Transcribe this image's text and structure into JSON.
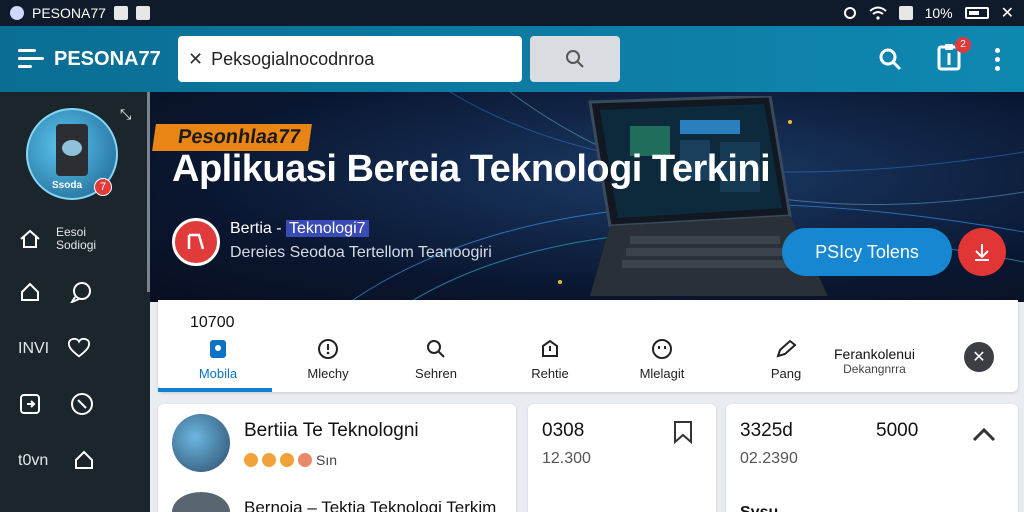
{
  "status_bar": {
    "app_name": "PESONA77",
    "battery": "10%"
  },
  "app_bar": {
    "brand": "PESONA77",
    "search_value": "Peksogialnocodnroa",
    "notification_count": "2"
  },
  "sidebar": {
    "avatar_label": "Ssoda",
    "avatar_badge": "7",
    "items": [
      {
        "icon": "home-icon",
        "label": "Eesoi\nSodiogi"
      },
      {
        "icon": "house-icon",
        "icon2": "chat-icon"
      },
      {
        "icon": "bars-icon",
        "label": "INVI",
        "icon2": "heart-icon"
      },
      {
        "icon": "login-icon",
        "icon2": "clock-icon"
      },
      {
        "icon": "grid-icon",
        "label": "t0vn",
        "icon2": "house-icon"
      }
    ]
  },
  "hero": {
    "tag": "Pesonhlaa77",
    "title": "Aplikuasi Bereia Teknologi Terkini",
    "source_prefix": "Bertia - ",
    "source_highlight": "Teknologi7",
    "source_sub": "Dereies Seodoa Tertellom Teanoogiri",
    "cta_label": "PSIcy Tolens"
  },
  "tabs": {
    "count": "10700",
    "items": [
      {
        "icon": "mobile-icon",
        "label": "Mobila",
        "active": true
      },
      {
        "icon": "info-icon",
        "label": "Mlechy"
      },
      {
        "icon": "search-icon",
        "label": "Sehren"
      },
      {
        "icon": "update-icon",
        "label": "Rehtie"
      },
      {
        "icon": "mask-icon",
        "label": "Mlelagit"
      },
      {
        "icon": "pen-icon",
        "label": "Pang"
      }
    ],
    "extra_title": "Ferankolenui",
    "extra_sub": "Dekangnrra"
  },
  "feed": {
    "card1": {
      "title": "Bertiia Te Teknologni",
      "reaction_label": "Sın",
      "title2": "Bernoia – Tektia Teknologi Terkim"
    },
    "card2": {
      "value": "0308",
      "sub": "12.300"
    },
    "card3": {
      "value": "3325d",
      "value2": "5000",
      "sub": "02.2390",
      "tail": "Sysu"
    }
  },
  "colors": {
    "appbar": "#0f88b1",
    "sidebar": "#1b252c",
    "accent_blue": "#1687d0",
    "accent_red": "#e23636",
    "tag_orange": "#e98514"
  }
}
